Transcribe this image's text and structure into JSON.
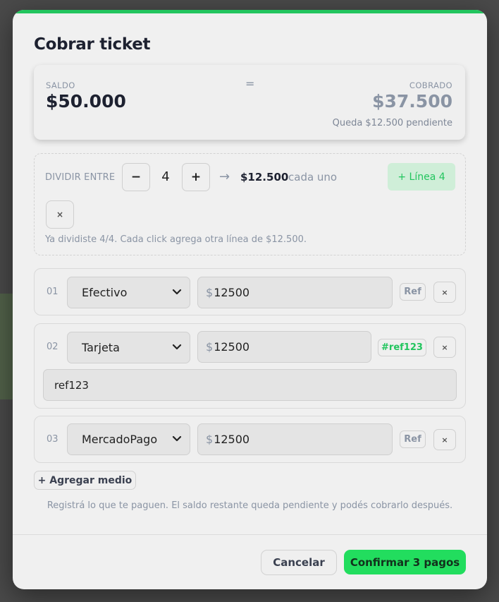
{
  "dialog": {
    "title": "Cobrar ticket"
  },
  "summary": {
    "saldo_label": "SALDO",
    "saldo_value": "$50.000",
    "equals": "=",
    "cobrado_label": "COBRADO",
    "cobrado_value": "$37.500",
    "pending_text": "Queda $12.500 pendiente"
  },
  "split": {
    "label": "DIVIDIR ENTRE",
    "minus": "−",
    "count": "4",
    "plus": "+",
    "arrow": "→",
    "per_amount": "$12.500",
    "per_suffix": "cada uno",
    "line_button": "+ Línea 4",
    "close": "×",
    "note": "Ya dividiste 4/4. Cada click agrega otra línea de $12.500."
  },
  "payments": [
    {
      "num": "01",
      "method": "Efectivo",
      "currency": "$",
      "amount": "12500",
      "ref_label": "Ref",
      "remove": "×"
    },
    {
      "num": "02",
      "method": "Tarjeta",
      "currency": "$",
      "amount": "12500",
      "ref_label": "#ref123",
      "remove": "×",
      "ref_value": "ref123"
    },
    {
      "num": "03",
      "method": "MercadoPago",
      "currency": "$",
      "amount": "12500",
      "ref_label": "Ref",
      "remove": "×"
    }
  ],
  "actions": {
    "add_method": "+ Agregar medio",
    "help": "Registrá lo que te paguen. El saldo restante queda pendiente y podés cobrarlo después.",
    "cancel": "Cancelar",
    "confirm": "Confirmar 3 pagos"
  },
  "colors": {
    "accent": "#22c55e",
    "confirm": "#22dd5e",
    "saldo": "#1d2130",
    "cobrado": "#8a94a4"
  }
}
